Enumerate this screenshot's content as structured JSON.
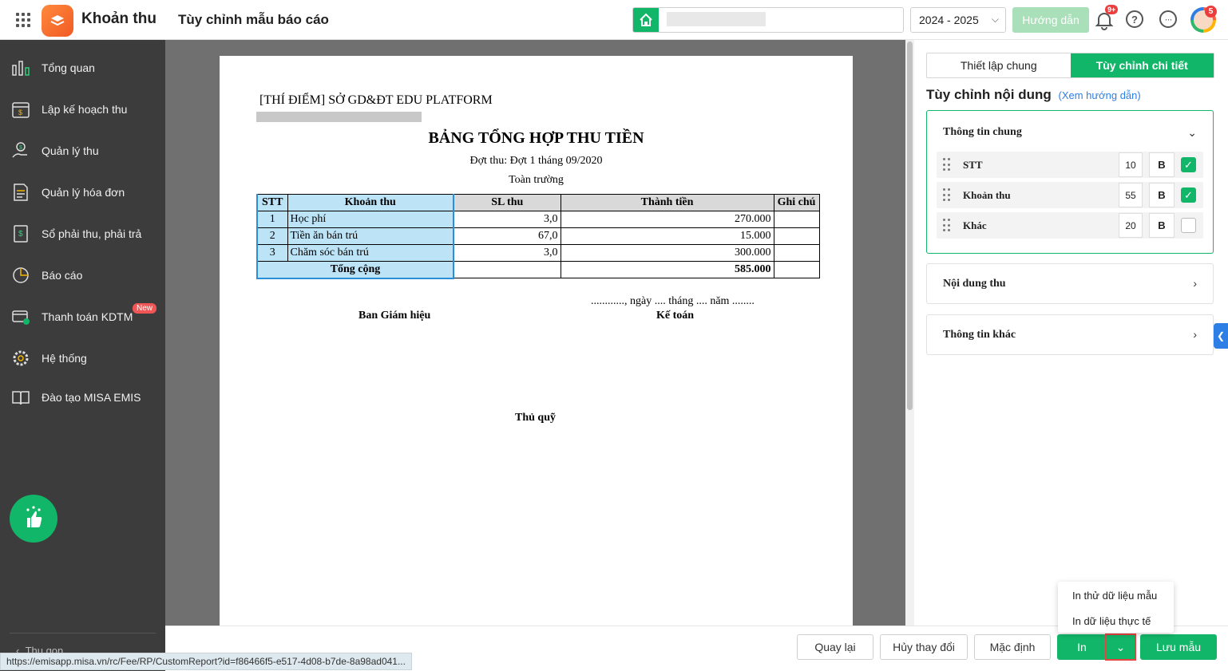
{
  "header": {
    "app_name": "Khoản thu",
    "page_title": "Tùy chỉnh mẫu báo cáo",
    "school_year": "2024 - 2025",
    "help_label": "Hướng dẫn",
    "notification_count": "9+",
    "avatar_badge": "5"
  },
  "sidebar": {
    "items": [
      {
        "label": "Tổng quan",
        "icon": "chart-bars-icon"
      },
      {
        "label": "Lập kế hoạch thu",
        "icon": "calendar-money-icon"
      },
      {
        "label": "Quản lý thu",
        "icon": "hand-money-icon"
      },
      {
        "label": "Quản lý hóa đơn",
        "icon": "invoice-icon"
      },
      {
        "label": "Sổ phải thu, phải trả",
        "icon": "ledger-icon"
      },
      {
        "label": "Báo cáo",
        "icon": "pie-chart-icon"
      },
      {
        "label": "Thanh toán KDTM",
        "icon": "card-check-icon"
      },
      {
        "label": "Hệ thống",
        "icon": "gear-icon"
      },
      {
        "label": "Đào tạo MISA EMIS",
        "icon": "book-icon"
      }
    ],
    "new_badge": "New",
    "collapse_label": "Thu gọn"
  },
  "report": {
    "org_name": "[THÍ ĐIỂM] SỞ GD&ĐT EDU PLATFORM",
    "title": "BẢNG TỔNG HỢP THU TIỀN",
    "period": "Đợt thu: Đợt 1 tháng 09/2020",
    "scope": "Toàn trường",
    "columns": [
      "STT",
      "Khoản thu",
      "SL thu",
      "Thành tiền",
      "Ghi chú"
    ],
    "rows": [
      {
        "stt": "1",
        "name": "Học phí",
        "qty": "3,0",
        "amount": "270.000",
        "note": ""
      },
      {
        "stt": "2",
        "name": "Tiền ăn bán trú",
        "qty": "67,0",
        "amount": "15.000",
        "note": ""
      },
      {
        "stt": "3",
        "name": "Chăm sóc bán trú",
        "qty": "3,0",
        "amount": "300.000",
        "note": ""
      }
    ],
    "total_label": "Tổng cộng",
    "total_amount": "585.000",
    "date_line": "............, ngày .... tháng .... năm ........",
    "sign_left": "Ban Giám hiệu",
    "sign_right": "Kế toán",
    "sign_bottom": "Thủ quỹ"
  },
  "panel": {
    "tabs": [
      "Thiết lập chung",
      "Tùy chỉnh chi tiết"
    ],
    "heading": "Tùy chỉnh nội dung",
    "guide_link": "(Xem hướng dẫn)",
    "sections": [
      {
        "title": "Thông tin chung",
        "fields": [
          {
            "label": "STT",
            "width": "10",
            "bold": "B",
            "visible": true
          },
          {
            "label": "Khoản thu",
            "width": "55",
            "bold": "B",
            "visible": true
          },
          {
            "label": "Khác",
            "width": "20",
            "bold": "B",
            "visible": false
          }
        ]
      },
      {
        "title": "Nội dung thu"
      },
      {
        "title": "Thông tin khác"
      }
    ]
  },
  "footer": {
    "back": "Quay lại",
    "discard": "Hủy thay đổi",
    "default": "Mặc định",
    "print": "In",
    "save": "Lưu mẫu",
    "print_menu": [
      "In thử dữ liệu mẫu",
      "In dữ liệu thực tế"
    ]
  },
  "status_url": "https://emisapp.misa.vn/rc/Fee/RP/CustomReport?id=f86466f5-e517-4d08-b7de-8a98ad041..."
}
